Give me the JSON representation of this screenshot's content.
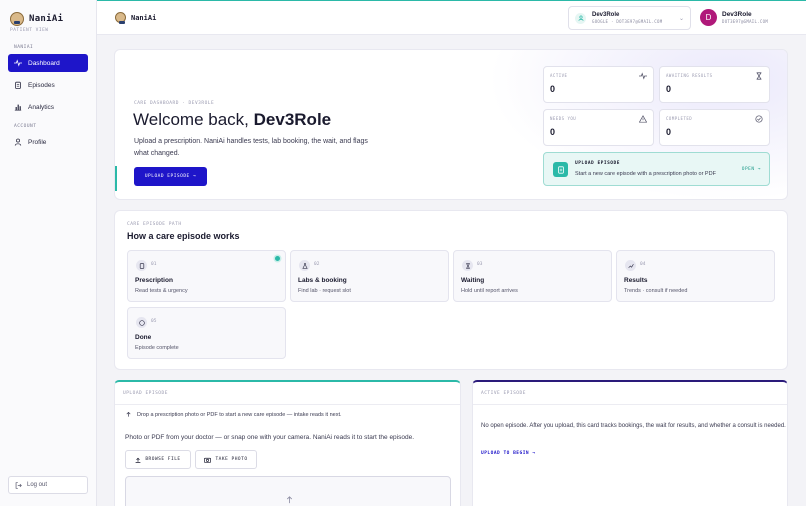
{
  "app": {
    "name": "NaniAi"
  },
  "sidebar": {
    "caption": "PATIENT VIEW",
    "section_main": "NANIAI",
    "items": [
      {
        "label": "Dashboard",
        "icon": "activity-icon",
        "active": true
      },
      {
        "label": "Episodes",
        "icon": "clipboard-icon"
      },
      {
        "label": "Analytics",
        "icon": "bar-chart-icon"
      }
    ],
    "section_account": "ACCOUNT",
    "profile": {
      "label": "Profile",
      "icon": "user-icon"
    },
    "logout": "Log out"
  },
  "header": {
    "brand": "NaniAi",
    "account": {
      "name": "Dev3Role",
      "provider_line": "GOOGLE · DOT3E97@GMAIL.COM"
    },
    "user": {
      "initial": "D",
      "name": "Dev3Role",
      "email": "DOT3E97@GMAIL.COM"
    }
  },
  "hero": {
    "breadcrumb": "CARE DASHBOARD · DEV3ROLE",
    "greeting": "Welcome back,",
    "username": "Dev3Role",
    "description": "Upload a prescription. NaniAi handles tests, lab booking, the wait, and flags what changed.",
    "cta": "UPLOAD EPISODE →",
    "stats": [
      {
        "label": "ACTIVE",
        "value": "0",
        "icon": "pulse-icon"
      },
      {
        "label": "AWAITING RESULTS",
        "value": "0",
        "icon": "hourglass-icon"
      },
      {
        "label": "NEEDS YOU",
        "value": "0",
        "icon": "warning-icon"
      },
      {
        "label": "COMPLETED",
        "value": "0",
        "icon": "check-circle-icon"
      }
    ],
    "upload_card": {
      "title": "UPLOAD EPISODE",
      "description": "Start a new care episode with a prescription photo or PDF",
      "action": "OPEN →"
    }
  },
  "flow": {
    "caption": "CARE EPISODE PATH",
    "title": "How a care episode works",
    "steps": [
      {
        "num": "01",
        "name": "Prescription",
        "desc": "Read tests & urgency",
        "icon": "clipboard-icon"
      },
      {
        "num": "02",
        "name": "Labs & booking",
        "desc": "Find lab · request slot",
        "icon": "flask-icon"
      },
      {
        "num": "03",
        "name": "Waiting",
        "desc": "Hold until report arrives",
        "icon": "hourglass-icon"
      },
      {
        "num": "04",
        "name": "Results",
        "desc": "Trends · consult if needed",
        "icon": "chart-icon"
      },
      {
        "num": "05",
        "name": "Done",
        "desc": "Episode complete",
        "icon": "check-circle-icon"
      }
    ]
  },
  "upload_panel": {
    "title": "UPLOAD EPISODE",
    "notice": "Drop a prescription photo or PDF to start a new care episode — intake reads it next.",
    "body": "Photo or PDF from your doctor — or snap one with your camera. NaniAi reads it to start the episode.",
    "browse": "BROWSE FILE",
    "take_photo": "TAKE PHOTO"
  },
  "active_panel": {
    "title": "ACTIVE EPISODE",
    "body": "No open episode. After you upload, this card tracks bookings, the wait for results, and whether a consult is needed.",
    "link": "UPLOAD TO BEGIN →"
  },
  "colors": {
    "primary": "#1e15c9",
    "teal": "#2bb9a8",
    "avatar": "#b0197a"
  }
}
